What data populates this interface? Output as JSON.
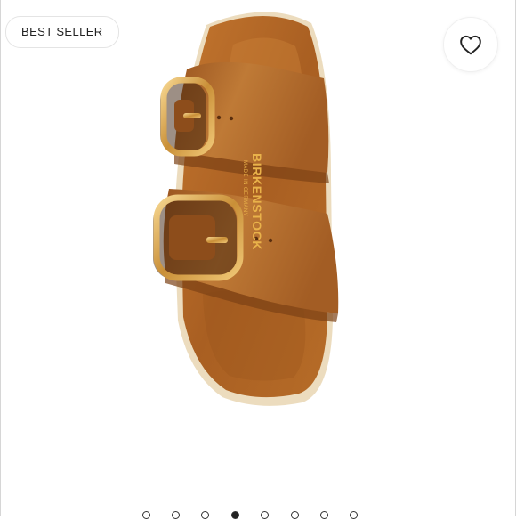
{
  "badge": {
    "label": "BEST SELLER"
  },
  "like": {
    "icon": "heart-icon",
    "color": "#222222"
  },
  "product": {
    "strap_text": "BIRKENSTOCK",
    "strap_subtext": "MADE IN GERMANY",
    "leather_color": "#b4692a",
    "buckle_color": "#d9a24a"
  },
  "carousel": {
    "count": 8,
    "active_index": 3
  }
}
